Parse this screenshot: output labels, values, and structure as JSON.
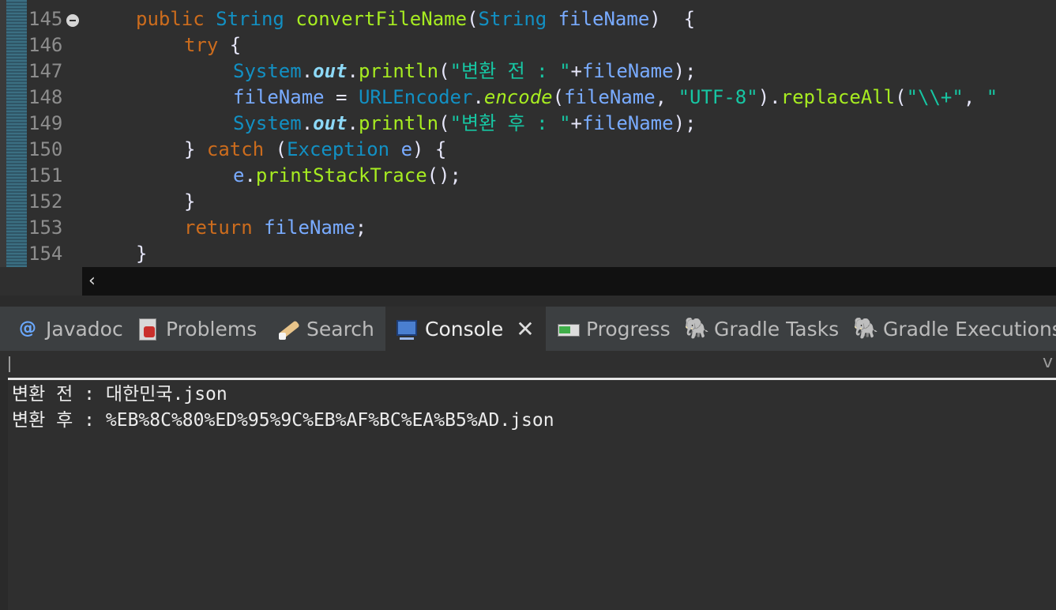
{
  "editor": {
    "lines": [
      {
        "num": "145",
        "folded": true,
        "indent": 172,
        "tokens": [
          {
            "t": "public",
            "c": "kw"
          },
          {
            "t": " ",
            "c": "pl"
          },
          {
            "t": "String",
            "c": "ty"
          },
          {
            "t": " ",
            "c": "pl"
          },
          {
            "t": "convertFileName",
            "c": "mth"
          },
          {
            "t": "(",
            "c": "pl"
          },
          {
            "t": "String",
            "c": "ty"
          },
          {
            "t": " ",
            "c": "pl"
          },
          {
            "t": "fileName",
            "c": "var"
          },
          {
            "t": ")  {",
            "c": "pl"
          }
        ]
      },
      {
        "num": "146",
        "folded": false,
        "indent": 233,
        "tokens": [
          {
            "t": "try",
            "c": "kw"
          },
          {
            "t": " {",
            "c": "pl"
          }
        ]
      },
      {
        "num": "147",
        "folded": false,
        "indent": 295,
        "tokens": [
          {
            "t": "System",
            "c": "ty"
          },
          {
            "t": ".",
            "c": "pl"
          },
          {
            "t": "out",
            "c": "fld"
          },
          {
            "t": ".",
            "c": "pl"
          },
          {
            "t": "println",
            "c": "mth"
          },
          {
            "t": "(",
            "c": "pl"
          },
          {
            "t": "\"변환 전 : \"",
            "c": "str"
          },
          {
            "t": "+",
            "c": "pl"
          },
          {
            "t": "fileName",
            "c": "var"
          },
          {
            "t": ");",
            "c": "pl"
          }
        ]
      },
      {
        "num": "148",
        "folded": false,
        "indent": 295,
        "tokens": [
          {
            "t": "fileName",
            "c": "var"
          },
          {
            "t": " = ",
            "c": "pl"
          },
          {
            "t": "URLEncoder",
            "c": "ty"
          },
          {
            "t": ".",
            "c": "pl"
          },
          {
            "t": "encode",
            "c": "mthi"
          },
          {
            "t": "(",
            "c": "pl"
          },
          {
            "t": "fileName",
            "c": "var"
          },
          {
            "t": ", ",
            "c": "pl"
          },
          {
            "t": "\"UTF-8\"",
            "c": "str"
          },
          {
            "t": ").",
            "c": "pl"
          },
          {
            "t": "replaceAll",
            "c": "mth"
          },
          {
            "t": "(",
            "c": "pl"
          },
          {
            "t": "\"\\\\+\"",
            "c": "str"
          },
          {
            "t": ", ",
            "c": "pl"
          },
          {
            "t": "\"",
            "c": "str"
          }
        ]
      },
      {
        "num": "149",
        "folded": false,
        "indent": 295,
        "tokens": [
          {
            "t": "System",
            "c": "ty"
          },
          {
            "t": ".",
            "c": "pl"
          },
          {
            "t": "out",
            "c": "fld"
          },
          {
            "t": ".",
            "c": "pl"
          },
          {
            "t": "println",
            "c": "mth"
          },
          {
            "t": "(",
            "c": "pl"
          },
          {
            "t": "\"변환 후 : \"",
            "c": "str"
          },
          {
            "t": "+",
            "c": "pl"
          },
          {
            "t": "fileName",
            "c": "var"
          },
          {
            "t": ");",
            "c": "pl"
          }
        ]
      },
      {
        "num": "150",
        "folded": false,
        "indent": 233,
        "tokens": [
          {
            "t": "} ",
            "c": "pl"
          },
          {
            "t": "catch",
            "c": "kw"
          },
          {
            "t": " (",
            "c": "pl"
          },
          {
            "t": "Exception",
            "c": "ty"
          },
          {
            "t": " ",
            "c": "pl"
          },
          {
            "t": "e",
            "c": "var"
          },
          {
            "t": ") {",
            "c": "pl"
          }
        ]
      },
      {
        "num": "151",
        "folded": false,
        "indent": 295,
        "tokens": [
          {
            "t": "e",
            "c": "var"
          },
          {
            "t": ".",
            "c": "pl"
          },
          {
            "t": "printStackTrace",
            "c": "mth"
          },
          {
            "t": "();",
            "c": "pl"
          }
        ]
      },
      {
        "num": "152",
        "folded": false,
        "indent": 233,
        "tokens": [
          {
            "t": "}",
            "c": "pl"
          }
        ]
      },
      {
        "num": "153",
        "folded": false,
        "indent": 233,
        "tokens": [
          {
            "t": "return",
            "c": "kw"
          },
          {
            "t": " ",
            "c": "pl"
          },
          {
            "t": "fileName",
            "c": "var"
          },
          {
            "t": ";",
            "c": "pl"
          }
        ]
      },
      {
        "num": "154",
        "folded": false,
        "indent": 172,
        "tokens": [
          {
            "t": "}",
            "c": "pl"
          }
        ]
      }
    ],
    "scroll_left_icon": "‹"
  },
  "tabs": [
    {
      "label": "Javadoc",
      "icon": "javadoc-icon",
      "active": false,
      "glyph": "@"
    },
    {
      "label": "Problems",
      "icon": "problems-icon",
      "active": false,
      "glyph": ""
    },
    {
      "label": "Search",
      "icon": "search-icon",
      "active": false,
      "glyph": ""
    },
    {
      "label": "Console",
      "icon": "console-icon",
      "active": true,
      "glyph": "",
      "close": "✕"
    },
    {
      "label": "Progress",
      "icon": "progress-icon",
      "active": false,
      "glyph": ""
    },
    {
      "label": "Gradle Tasks",
      "icon": "gradle-icon",
      "active": false,
      "glyph": "🐘"
    },
    {
      "label": "Gradle Executions",
      "icon": "gradle-icon",
      "active": false,
      "glyph": "🐘"
    }
  ],
  "console_toolbar": {
    "right_text": "v"
  },
  "console": {
    "lines": [
      "변환 전 : 대한민국.json",
      "변환 후 : %EB%8C%80%ED%95%9C%EB%AF%BC%EA%B5%AD.json"
    ]
  }
}
